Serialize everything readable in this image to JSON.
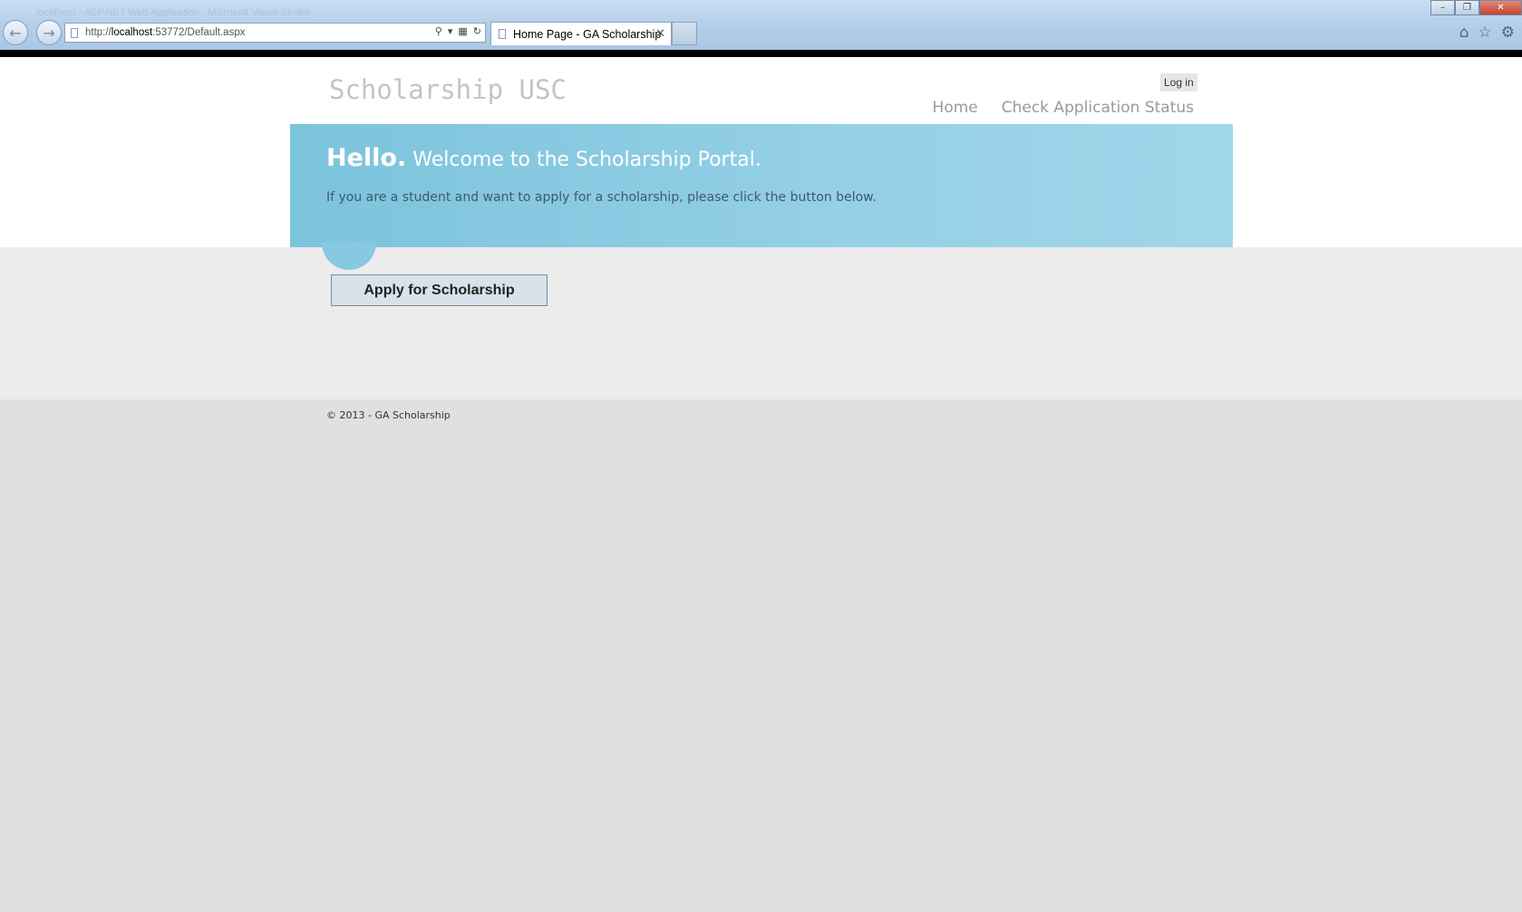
{
  "browser": {
    "faded_title": "localhost - ASP.NET Web Application - Microsoft Visual Studio",
    "url_prefix": "http://",
    "url_host": "localhost",
    "url_rest": ":53772/Default.aspx",
    "tab_title": "Home Page - GA Scholarship",
    "tab_close": "✕"
  },
  "site": {
    "title": "Scholarship USC",
    "login_label": "Log in",
    "menu": [
      {
        "label": "Home"
      },
      {
        "label": "Check Application Status"
      }
    ]
  },
  "featured": {
    "hello": "Hello.",
    "welcome": "Welcome to the Scholarship Portal.",
    "intro": "If you are a student and want to apply for a scholarship, please click the button below."
  },
  "main": {
    "apply_label": "Apply for Scholarship"
  },
  "footer": {
    "text": "© 2013 - GA Scholarship"
  },
  "colors": {
    "featured_bg": "#7cc3dc",
    "main_bg": "#ececec",
    "page_bg": "#e0e0e0"
  }
}
